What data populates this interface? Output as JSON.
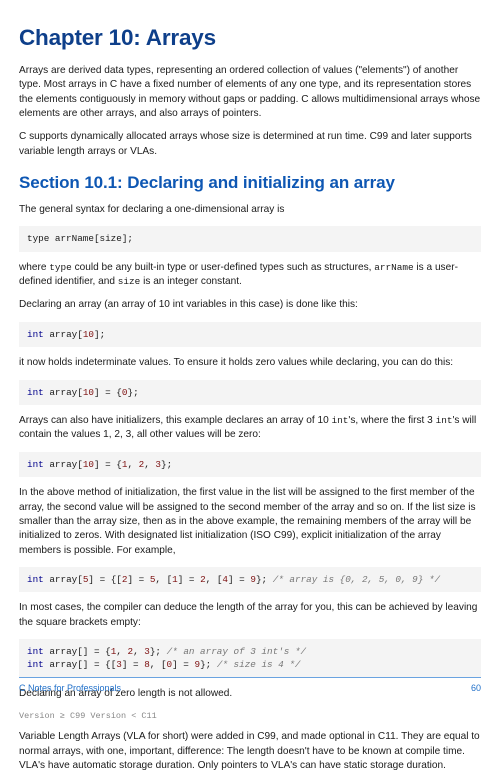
{
  "title": "Chapter 10: Arrays",
  "p1": "Arrays are derived data types, representing an ordered collection of values (\"elements\") of another type. Most arrays in C have a fixed number of elements of any one type, and its representation stores the elements contiguously in memory without gaps or padding. C allows multidimensional arrays whose elements are other arrays, and also arrays of pointers.",
  "p2": "C supports dynamically allocated arrays whose size is determined at run time. C99 and later supports variable length arrays or VLAs.",
  "section1": "Section 10.1: Declaring and initializing an array",
  "p3": "The general syntax for declaring a one-dimensional array is",
  "p4a": "where ",
  "p4b": " could be any built-in type or user-defined types such as structures, ",
  "p4c": " is a user-defined identifier, and ",
  "p4d": " is an integer constant.",
  "p5": "Declaring an array (an array of 10 int variables in this case) is done like this:",
  "p6": "it now holds indeterminate values. To ensure it holds zero values while declaring, you can do this:",
  "p7a": "Arrays can also have initializers, this example declares an array of 10 ",
  "p7b": "'s, where the first 3 ",
  "p7c": "'s will contain the values 1, 2, 3, all other values will be zero:",
  "p8": "In the above method of initialization, the first value in the list will be assigned to the first member of the array, the second value will be assigned to the second member of the array and so on. If the list size is smaller than the array size, then as in the above example, the remaining members of the array will be initialized to zeros. With designated list initialization (ISO C99), explicit initialization of the array members is possible. For example,",
  "p9": "In most cases, the compiler can deduce the length of the array for you, this can be achieved by leaving the square brackets empty:",
  "p10": "Declaring an array of zero length is not allowed.",
  "ver": "Version ≥ C99 Version < C11",
  "p11": "Variable Length Arrays (VLA for short) were added in C99, and made optional in C11. They are equal to normal arrays, with one, important, difference: The length doesn't have to be known at compile time. VLA's have automatic storage duration. Only pointers to VLA's can have static storage duration.",
  "inline": {
    "type": "type",
    "arrName": "arrName",
    "size": "size",
    "int": "int"
  },
  "footer": {
    "left": "C Notes for Professionals",
    "right": "60"
  }
}
